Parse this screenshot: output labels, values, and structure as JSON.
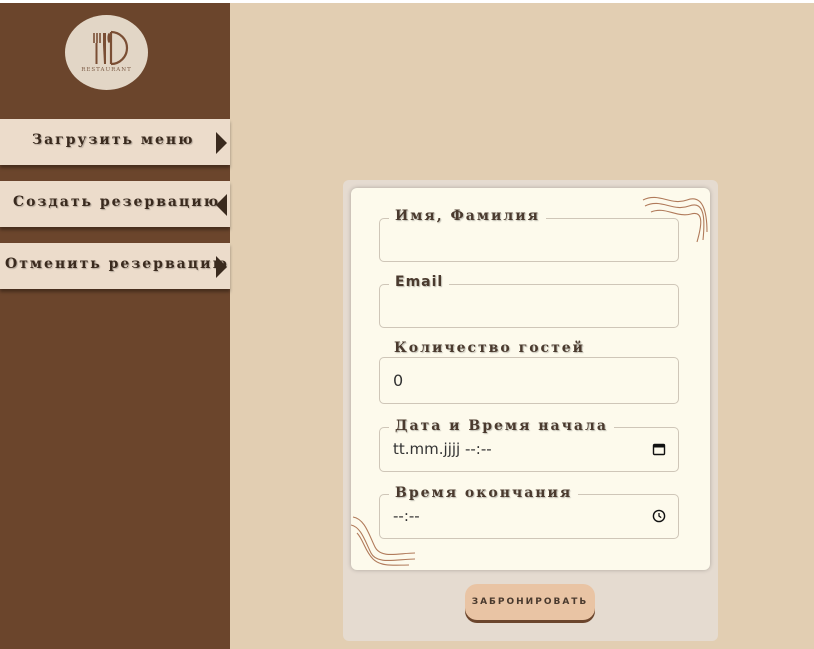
{
  "logo": {
    "text": "RESTAURANT",
    "icon": "fork-knife-spoon-plate-icon"
  },
  "sidebar": {
    "items": [
      {
        "label": "Загрузить меню",
        "arrow": "right"
      },
      {
        "label": "Создать резервацию",
        "arrow": "left"
      },
      {
        "label": "Отменить резервацию",
        "arrow": "right"
      }
    ]
  },
  "form": {
    "name_label": "Имя, Фамилия",
    "name_value": "",
    "email_label": "Email",
    "email_value": "",
    "guests_label": "Количество гостей",
    "guests_value": "0",
    "start_label": "Дата и Время начала",
    "start_value": "tt.mm.jjjj --:--",
    "end_label": "Время окончания",
    "end_value": "--:--",
    "submit_label": "ЗАБРОНИРОВАТЬ"
  },
  "colors": {
    "sidebar": "#6b452c",
    "background": "#e2ceb2",
    "nav_item": "#ecdccb",
    "card": "#fdfaec",
    "button": "#e9c4a4"
  }
}
